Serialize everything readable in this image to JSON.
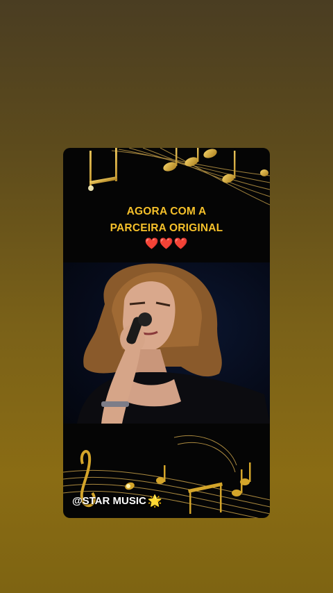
{
  "story": {
    "caption_line1": "AGORA COM A",
    "caption_line2": "PARCEIRA ORIGINAL",
    "hearts": "❤️❤️❤️",
    "handle": "@STAR MUSIC",
    "handle_emoji": "🌟"
  },
  "colors": {
    "caption": "#f5c02a",
    "background_top": "#4a3d22",
    "background_bottom": "#8a6c14",
    "notes": "#d4a52a"
  },
  "icons": [
    "music-notes-decoration",
    "star-icon"
  ]
}
